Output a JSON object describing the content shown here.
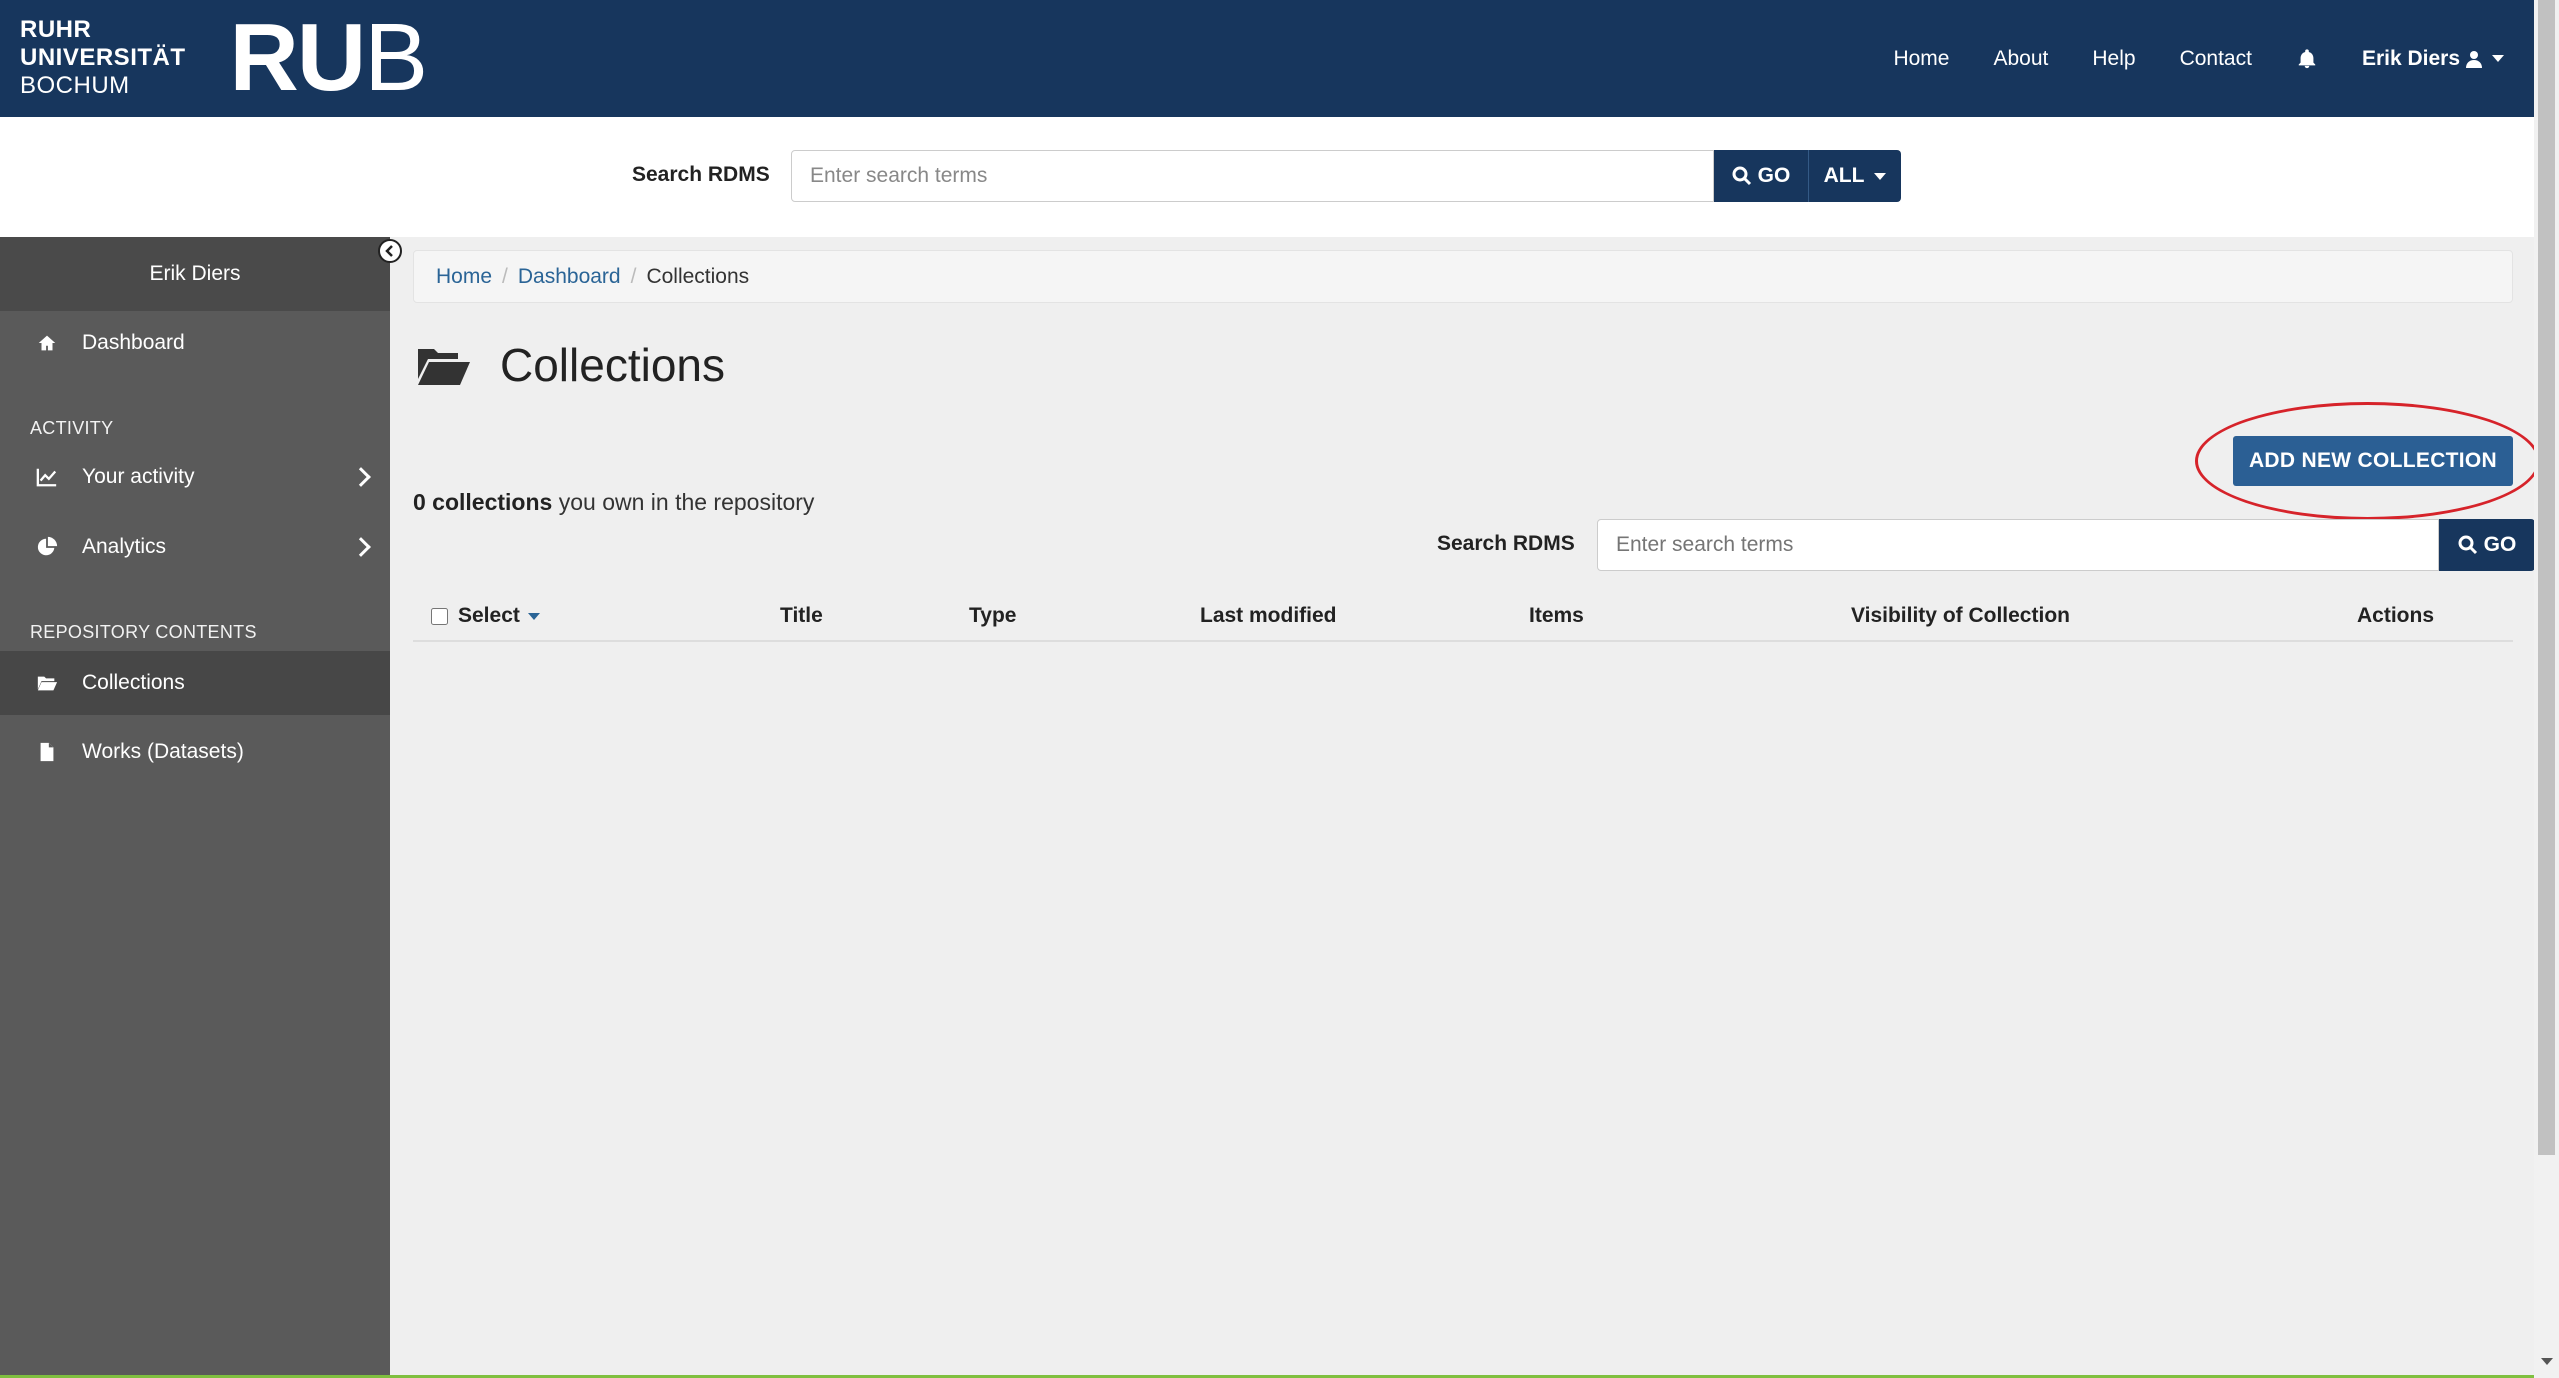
{
  "brand": {
    "line1": "RUHR",
    "line2": "UNIVERSITÄT",
    "line3": "BOCHUM",
    "mark_bold": "RU",
    "mark_light": "B"
  },
  "nav": {
    "home": "Home",
    "about": "About",
    "help": "Help",
    "contact": "Contact",
    "user": "Erik Diers"
  },
  "header_search": {
    "label": "Search RDMS",
    "placeholder": "Enter search terms",
    "go": "GO",
    "scope": "ALL"
  },
  "sidebar": {
    "user": "Erik Diers",
    "dashboard": "Dashboard",
    "section_activity": "ACTIVITY",
    "your_activity": "Your activity",
    "analytics": "Analytics",
    "section_repo": "REPOSITORY CONTENTS",
    "collections": "Collections",
    "works": "Works (Datasets)"
  },
  "breadcrumb": {
    "home": "Home",
    "dashboard": "Dashboard",
    "current": "Collections"
  },
  "page": {
    "title": "Collections",
    "add_button": "ADD NEW COLLECTION",
    "count_bold": "0 collections",
    "count_rest": " you own in the repository"
  },
  "collection_search": {
    "label": "Search RDMS",
    "placeholder": "Enter search terms",
    "go": "GO"
  },
  "table": {
    "select": "Select",
    "title": "Title",
    "type": "Type",
    "last_modified": "Last modified",
    "items": "Items",
    "visibility": "Visibility of Collection",
    "actions": "Actions"
  },
  "colors": {
    "navbar": "#17365d",
    "sidebar": "#5a5a5a",
    "primary_button": "#2b5f94",
    "highlight": "#d6232a"
  }
}
